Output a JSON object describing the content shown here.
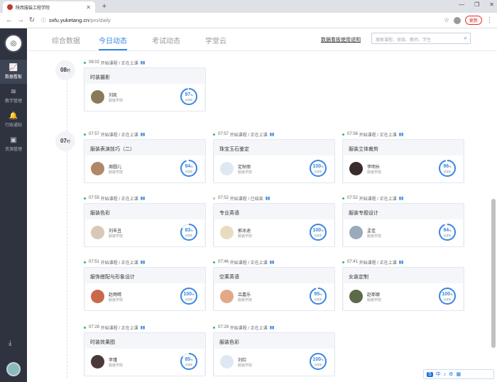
{
  "browser": {
    "tab_title": "陕西服装工程学院",
    "url_host": "sxfu.yuketang.cn",
    "url_path": "/pro/daily",
    "update_label": "更新"
  },
  "sidebar": {
    "logo_text": "◎",
    "items": [
      {
        "label": "数据看板",
        "icon": "chart-icon"
      },
      {
        "label": "教学管理",
        "icon": "layers-icon"
      },
      {
        "label": "行政通知",
        "icon": "bell-icon"
      },
      {
        "label": "资源管理",
        "icon": "briefcase-icon"
      }
    ]
  },
  "topnav": {
    "tabs": [
      "综合数据",
      "今日动态",
      "考试动态",
      "学堂云"
    ],
    "active_index": 1,
    "link": "数据看板使用说明",
    "search_placeholder": "搜索课程、班级、教师、学生"
  },
  "hours": [
    {
      "value": "08",
      "unit": "时"
    },
    {
      "value": "07",
      "unit": "时"
    }
  ],
  "status_live": "开始课程 / 正在上课",
  "status_ended": "开始课程 / 已结束",
  "school": "服装学院",
  "ring_label": "到课率",
  "percent_unit": "%",
  "colors": {
    "accent": "#3a86e0",
    "live": "#2dbb6b",
    "sidebar": "#2f3340"
  },
  "courses": [
    {
      "time": "08:02",
      "status": "live",
      "name": "时装摄影",
      "teacher": "刘凯",
      "rate": 97
    },
    {
      "time": "07:57",
      "status": "live",
      "name": "服装表演技巧（二）",
      "teacher": "周圆儿",
      "rate": 94
    },
    {
      "time": "07:57",
      "status": "live",
      "name": "珠宝玉石鉴定",
      "teacher": "定秋丽",
      "rate": 100
    },
    {
      "time": "07:56",
      "status": "live",
      "name": "服装立体裁剪",
      "teacher": "李明长",
      "rate": 96
    },
    {
      "time": "07:55",
      "status": "live",
      "name": "服装色彩",
      "teacher": "刘丰丑",
      "rate": 83
    },
    {
      "time": "07:52",
      "status": "ended",
      "name": "专业英语",
      "teacher": "郭冰迪",
      "rate": 100
    },
    {
      "time": "07:52",
      "status": "live",
      "name": "服装专题设计",
      "teacher": "孟佳",
      "rate": 94
    },
    {
      "time": "07:51",
      "status": "live",
      "name": "服饰搭配与形象设计",
      "teacher": "赵雨晴",
      "rate": 100
    },
    {
      "time": "07:46",
      "status": "live",
      "name": "空乘英语",
      "teacher": "吕嘉乐",
      "rate": 95
    },
    {
      "time": "07:41",
      "status": "live",
      "name": "女装定制",
      "teacher": "赵耶娜",
      "rate": 100
    },
    {
      "time": "07:28",
      "status": "live",
      "name": "时装效果图",
      "teacher": "李瑾",
      "rate": 85
    },
    {
      "time": "07:28",
      "status": "live",
      "name": "服装色彩",
      "teacher": "刘红",
      "rate": 100
    }
  ],
  "ime": {
    "label": "中"
  }
}
